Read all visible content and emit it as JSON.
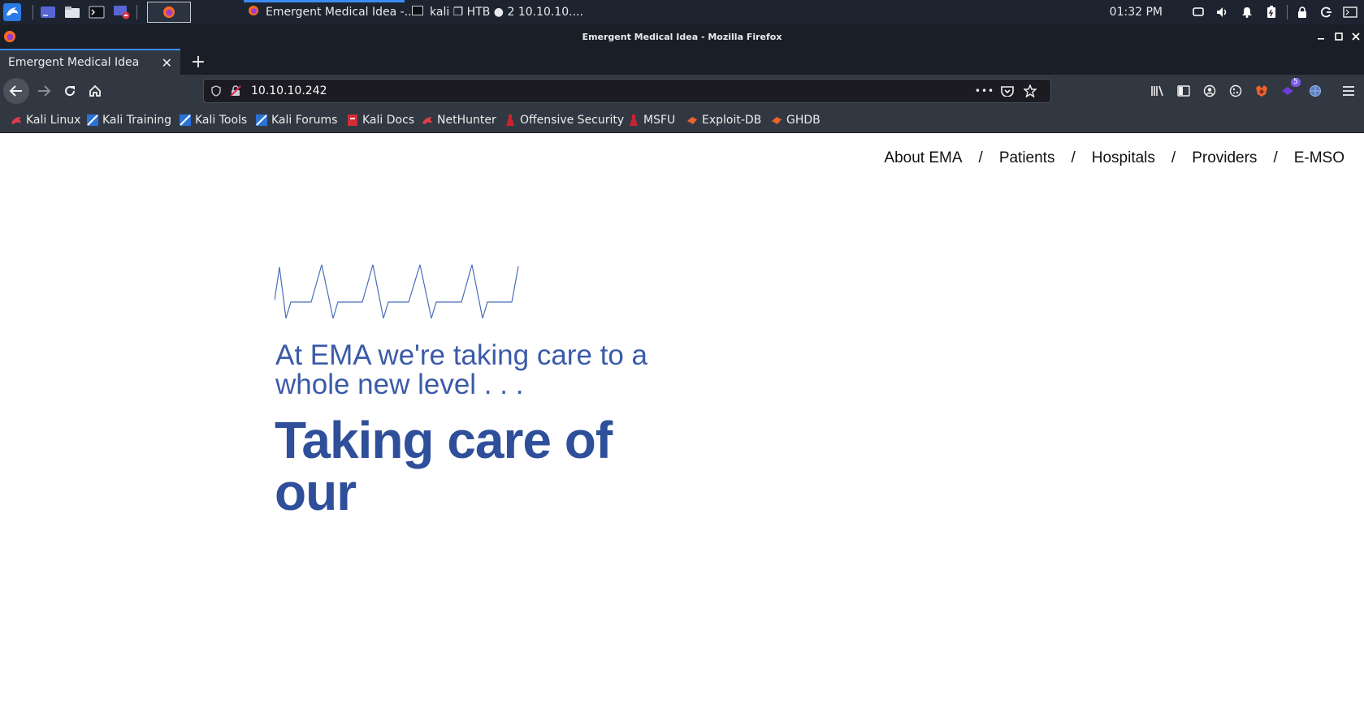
{
  "panel": {
    "tasks": [
      {
        "title": "Emergent Medical Idea -..."
      },
      {
        "title": "kali ❐ HTB ● 2 10.10.10...."
      }
    ],
    "clock": "01:32 PM"
  },
  "window": {
    "title": "Emergent Medical Idea - Mozilla Firefox"
  },
  "tab": {
    "title": "Emergent Medical Idea",
    "close": "✕",
    "new_tab": "+"
  },
  "urlbar": {
    "url": "10.10.10.242",
    "more": "•••"
  },
  "toolbar": {
    "extension_badge": "5"
  },
  "bookmarks": [
    {
      "label": "Kali Linux",
      "icon": "kali-dragon-icon"
    },
    {
      "label": "Kali Training",
      "icon": "kali-training-icon"
    },
    {
      "label": "Kali Tools",
      "icon": "kali-tools-icon"
    },
    {
      "label": "Kali Forums",
      "icon": "kali-forums-icon"
    },
    {
      "label": "Kali Docs",
      "icon": "kali-docs-icon"
    },
    {
      "label": "NetHunter",
      "icon": "nethunter-icon"
    },
    {
      "label": "Offensive Security",
      "icon": "offsec-icon"
    },
    {
      "label": "MSFU",
      "icon": "msfu-icon"
    },
    {
      "label": "Exploit-DB",
      "icon": "exploit-db-icon"
    },
    {
      "label": "GHDB",
      "icon": "ghdb-icon"
    }
  ],
  "site": {
    "nav": [
      {
        "label": "About EMA"
      },
      {
        "label": "Patients"
      },
      {
        "label": "Hospitals"
      },
      {
        "label": "Providers"
      },
      {
        "label": "E-MSO"
      }
    ],
    "separator": "/",
    "tagline": "At EMA we're taking care to a whole new level . . .",
    "headline": "Taking care of our"
  },
  "colors": {
    "panel_bg": "#1d2430",
    "browser_chrome": "#323842",
    "tab_accent": "#3d8bf7",
    "tagline": "#3b5ba8",
    "headline": "#2f4f9a"
  }
}
